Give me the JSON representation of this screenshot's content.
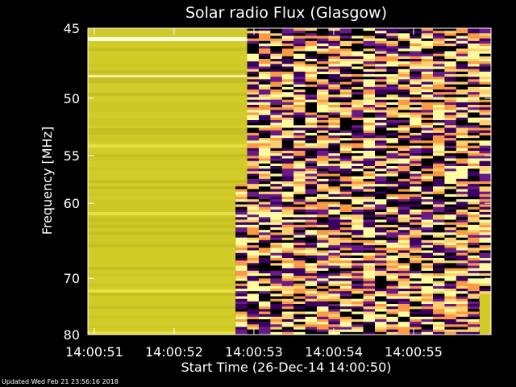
{
  "chart_data": {
    "type": "heatmap",
    "title": "Solar radio Flux (Glasgow)",
    "xlabel": "Start Time (26-Dec-14 14:00:50)",
    "ylabel": "Frequency [MHz]",
    "x_ticks": [
      "14:00:51",
      "14:00:52",
      "14:00:53",
      "14:00:54",
      "14:00:55"
    ],
    "x_tick_seconds": [
      1,
      2,
      3,
      4,
      5
    ],
    "xlim_seconds": [
      0.92,
      5.97
    ],
    "y_ticks": [
      45,
      50,
      55,
      60,
      70,
      80
    ],
    "ylim_mhz": [
      45,
      80
    ],
    "y_scale": "reciprocal",
    "saturated_region": {
      "until_seconds": 3.0,
      "until_seconds_high_freq": 2.77,
      "high_freq_from_mhz": 58,
      "color": "#d2cc28"
    },
    "noise_region": {
      "from_seconds": 2.77,
      "palette": [
        "#000000",
        "#3b0060",
        "#6a1a86",
        "#fb9a46",
        "#fffba0",
        "#fcd070"
      ]
    },
    "columns_noise": 22,
    "rows_noise": 120,
    "grid": false,
    "legend": "none"
  },
  "footer_text": "Updated Wed Feb 21 23:56:16 2018"
}
